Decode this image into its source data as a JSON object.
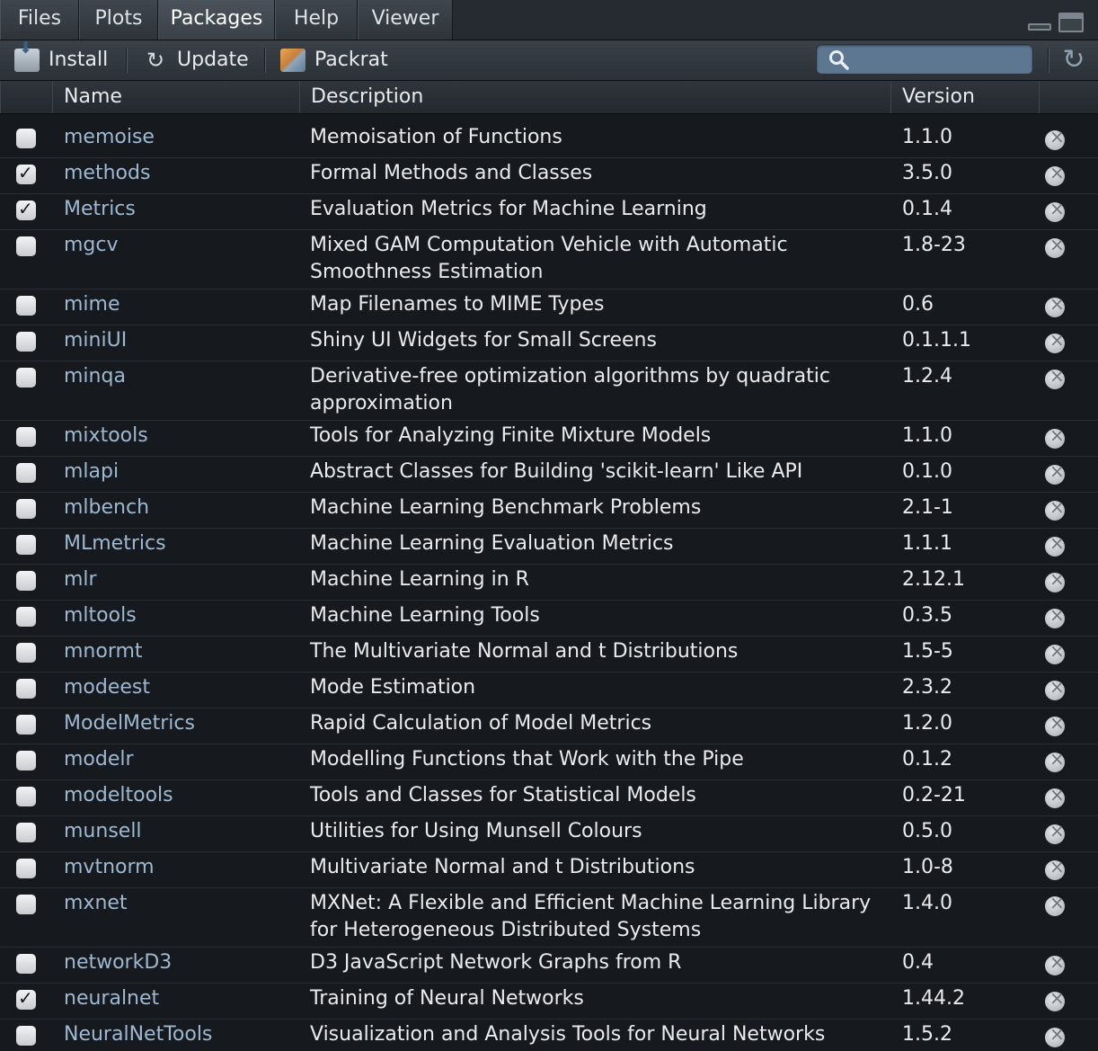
{
  "tabs": [
    {
      "label": "Files"
    },
    {
      "label": "Plots"
    },
    {
      "label": "Packages"
    },
    {
      "label": "Help"
    },
    {
      "label": "Viewer"
    }
  ],
  "toolbar": {
    "install_label": "Install",
    "update_label": "Update",
    "packrat_label": "Packrat",
    "search_value": ""
  },
  "columns": {
    "name": "Name",
    "description": "Description",
    "version": "Version"
  },
  "packages": [
    {
      "name": "memoise",
      "description": "Memoisation of Functions",
      "version": "1.1.0",
      "checked": false
    },
    {
      "name": "methods",
      "description": "Formal Methods and Classes",
      "version": "3.5.0",
      "checked": true
    },
    {
      "name": "Metrics",
      "description": "Evaluation Metrics for Machine Learning",
      "version": "0.1.4",
      "checked": true
    },
    {
      "name": "mgcv",
      "description": "Mixed GAM Computation Vehicle with Automatic Smoothness Estimation",
      "version": "1.8-23",
      "checked": false
    },
    {
      "name": "mime",
      "description": "Map Filenames to MIME Types",
      "version": "0.6",
      "checked": false
    },
    {
      "name": "miniUI",
      "description": "Shiny UI Widgets for Small Screens",
      "version": "0.1.1.1",
      "checked": false
    },
    {
      "name": "minqa",
      "description": "Derivative-free optimization algorithms by quadratic approximation",
      "version": "1.2.4",
      "checked": false
    },
    {
      "name": "mixtools",
      "description": "Tools for Analyzing Finite Mixture Models",
      "version": "1.1.0",
      "checked": false
    },
    {
      "name": "mlapi",
      "description": "Abstract Classes for Building 'scikit-learn' Like API",
      "version": "0.1.0",
      "checked": false
    },
    {
      "name": "mlbench",
      "description": "Machine Learning Benchmark Problems",
      "version": "2.1-1",
      "checked": false
    },
    {
      "name": "MLmetrics",
      "description": "Machine Learning Evaluation Metrics",
      "version": "1.1.1",
      "checked": false
    },
    {
      "name": "mlr",
      "description": "Machine Learning in R",
      "version": "2.12.1",
      "checked": false
    },
    {
      "name": "mltools",
      "description": "Machine Learning Tools",
      "version": "0.3.5",
      "checked": false
    },
    {
      "name": "mnormt",
      "description": "The Multivariate Normal and t Distributions",
      "version": "1.5-5",
      "checked": false
    },
    {
      "name": "modeest",
      "description": "Mode Estimation",
      "version": "2.3.2",
      "checked": false
    },
    {
      "name": "ModelMetrics",
      "description": "Rapid Calculation of Model Metrics",
      "version": "1.2.0",
      "checked": false
    },
    {
      "name": "modelr",
      "description": "Modelling Functions that Work with the Pipe",
      "version": "0.1.2",
      "checked": false
    },
    {
      "name": "modeltools",
      "description": "Tools and Classes for Statistical Models",
      "version": "0.2-21",
      "checked": false
    },
    {
      "name": "munsell",
      "description": "Utilities for Using Munsell Colours",
      "version": "0.5.0",
      "checked": false
    },
    {
      "name": "mvtnorm",
      "description": "Multivariate Normal and t Distributions",
      "version": "1.0-8",
      "checked": false
    },
    {
      "name": "mxnet",
      "description": "MXNet: A Flexible and Efficient Machine Learning Library for Heterogeneous Distributed Systems",
      "version": "1.4.0",
      "checked": false
    },
    {
      "name": "networkD3",
      "description": "D3 JavaScript Network Graphs from R",
      "version": "0.4",
      "checked": false
    },
    {
      "name": "neuralnet",
      "description": "Training of Neural Networks",
      "version": "1.44.2",
      "checked": true
    },
    {
      "name": "NeuralNetTools",
      "description": "Visualization and Analysis Tools for Neural Networks",
      "version": "1.5.2",
      "checked": false
    }
  ]
}
